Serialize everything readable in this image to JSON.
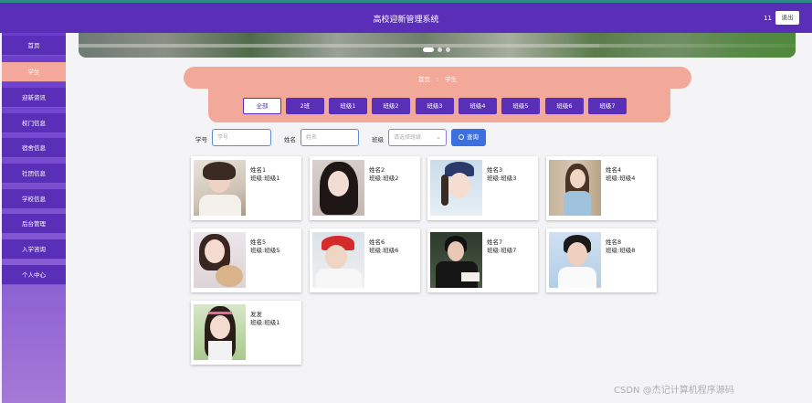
{
  "header": {
    "title": "高校迎新管理系统",
    "user": "11",
    "logout": "退出"
  },
  "sidebar": {
    "items": [
      {
        "label": "首页"
      },
      {
        "label": "学生",
        "active": true
      },
      {
        "label": "迎新资讯"
      },
      {
        "label": "校门信息"
      },
      {
        "label": "宿舍信息"
      },
      {
        "label": "社团信息"
      },
      {
        "label": "学校信息"
      },
      {
        "label": "后台管理"
      },
      {
        "label": "入学咨询"
      },
      {
        "label": "个人中心"
      }
    ]
  },
  "breadcrumb": {
    "home": "首页",
    "separator": ":",
    "current": "学生"
  },
  "filters": {
    "chips": [
      "全部",
      "2班",
      "班级1",
      "班级2",
      "班级3",
      "班级4",
      "班级5",
      "班级6",
      "班级7"
    ],
    "selected_index": 0
  },
  "search": {
    "student_no_label": "学号",
    "student_no_placeholder": "学号",
    "name_label": "姓名",
    "name_placeholder": "姓名",
    "class_label": "班级",
    "class_placeholder": "请选择班级",
    "button_label": "查询"
  },
  "students": [
    {
      "name": "姓名1",
      "class": "班级:班级1"
    },
    {
      "name": "姓名2",
      "class": "班级:班级2"
    },
    {
      "name": "姓名3",
      "class": "班级:班级3"
    },
    {
      "name": "姓名4",
      "class": "班级:班级4"
    },
    {
      "name": "姓名5",
      "class": "班级:班级5"
    },
    {
      "name": "姓名6",
      "class": "班级:班级6"
    },
    {
      "name": "姓名7",
      "class": "班级:班级7"
    },
    {
      "name": "姓名8",
      "class": "班级:班级8"
    },
    {
      "name": "发发",
      "class": "班级:班级1"
    }
  ],
  "watermark": "CSDN @杰记计算机程序源码",
  "colors": {
    "primary": "#5a2fb8",
    "accent": "#f2a99a",
    "search_button": "#3c6fe0"
  }
}
